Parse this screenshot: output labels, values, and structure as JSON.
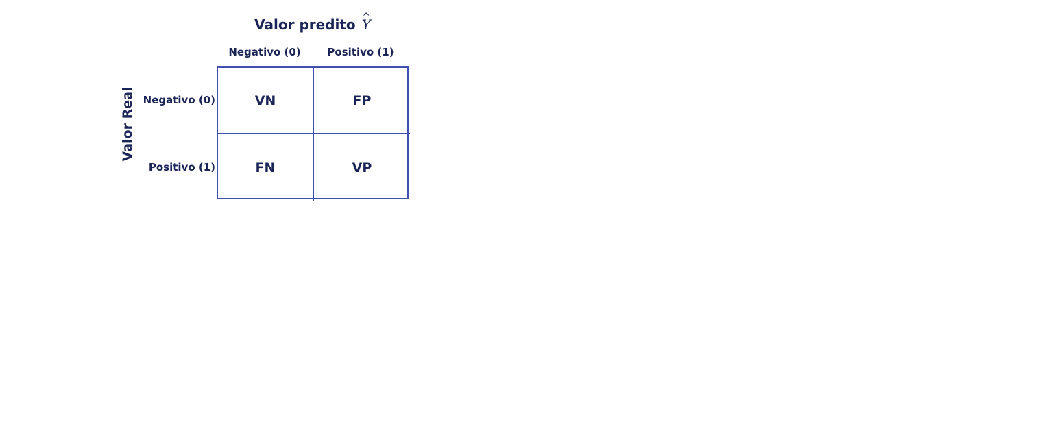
{
  "colors": {
    "text": "#1a2456",
    "grid": "#3f51b5",
    "background": "#ffffff"
  },
  "title": {
    "text": "Valor predito",
    "symbol": "Y"
  },
  "columns": {
    "negative": "Negativo (0)",
    "positive": "Positivo (1)"
  },
  "rows": {
    "axis_label": "Valor Real",
    "negative": "Negativo (0)",
    "positive": "Positivo (1)"
  },
  "cells": {
    "tn": "VN",
    "fp": "FP",
    "fn": "FN",
    "tp": "VP"
  }
}
